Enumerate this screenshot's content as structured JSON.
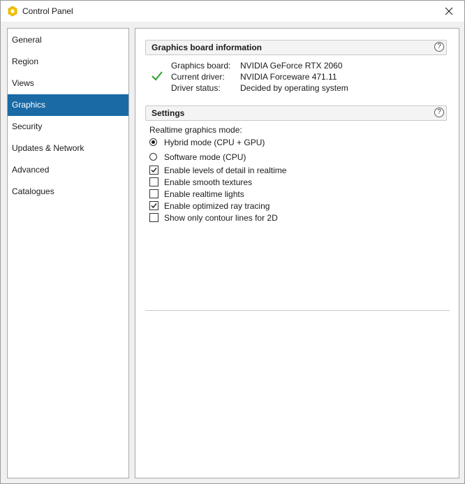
{
  "window": {
    "title": "Control Panel"
  },
  "sidebar": {
    "items": [
      {
        "label": "General"
      },
      {
        "label": "Region"
      },
      {
        "label": "Views"
      },
      {
        "label": "Graphics",
        "selected": true
      },
      {
        "label": "Security"
      },
      {
        "label": "Updates & Network"
      },
      {
        "label": "Advanced"
      },
      {
        "label": "Catalogues"
      }
    ]
  },
  "graphics_info": {
    "title": "Graphics board information",
    "help": "?",
    "rows": [
      {
        "label": "Graphics board:",
        "value": "NVIDIA GeForce RTX 2060"
      },
      {
        "label": "Current driver:",
        "value": "NVIDIA Forceware 471.11"
      },
      {
        "label": "Driver status:",
        "value": "Decided by operating system"
      }
    ]
  },
  "settings": {
    "title": "Settings",
    "help": "?",
    "mode_label": "Realtime graphics mode:",
    "radios": [
      {
        "label": "Hybrid mode (CPU + GPU)",
        "checked": true
      },
      {
        "label": "Software mode (CPU)",
        "checked": false
      }
    ],
    "checkboxes": [
      {
        "label": "Enable levels of detail in realtime",
        "checked": true
      },
      {
        "label": "Enable smooth textures",
        "checked": false
      },
      {
        "label": "Enable realtime lights",
        "checked": false
      },
      {
        "label": "Enable optimized ray tracing",
        "checked": true
      },
      {
        "label": "Show only contour lines for 2D",
        "checked": false
      }
    ]
  },
  "colors": {
    "selected_nav": "#1a6aa6",
    "app_icon": "#f2c200",
    "status_ok": "#2e9e2e"
  }
}
